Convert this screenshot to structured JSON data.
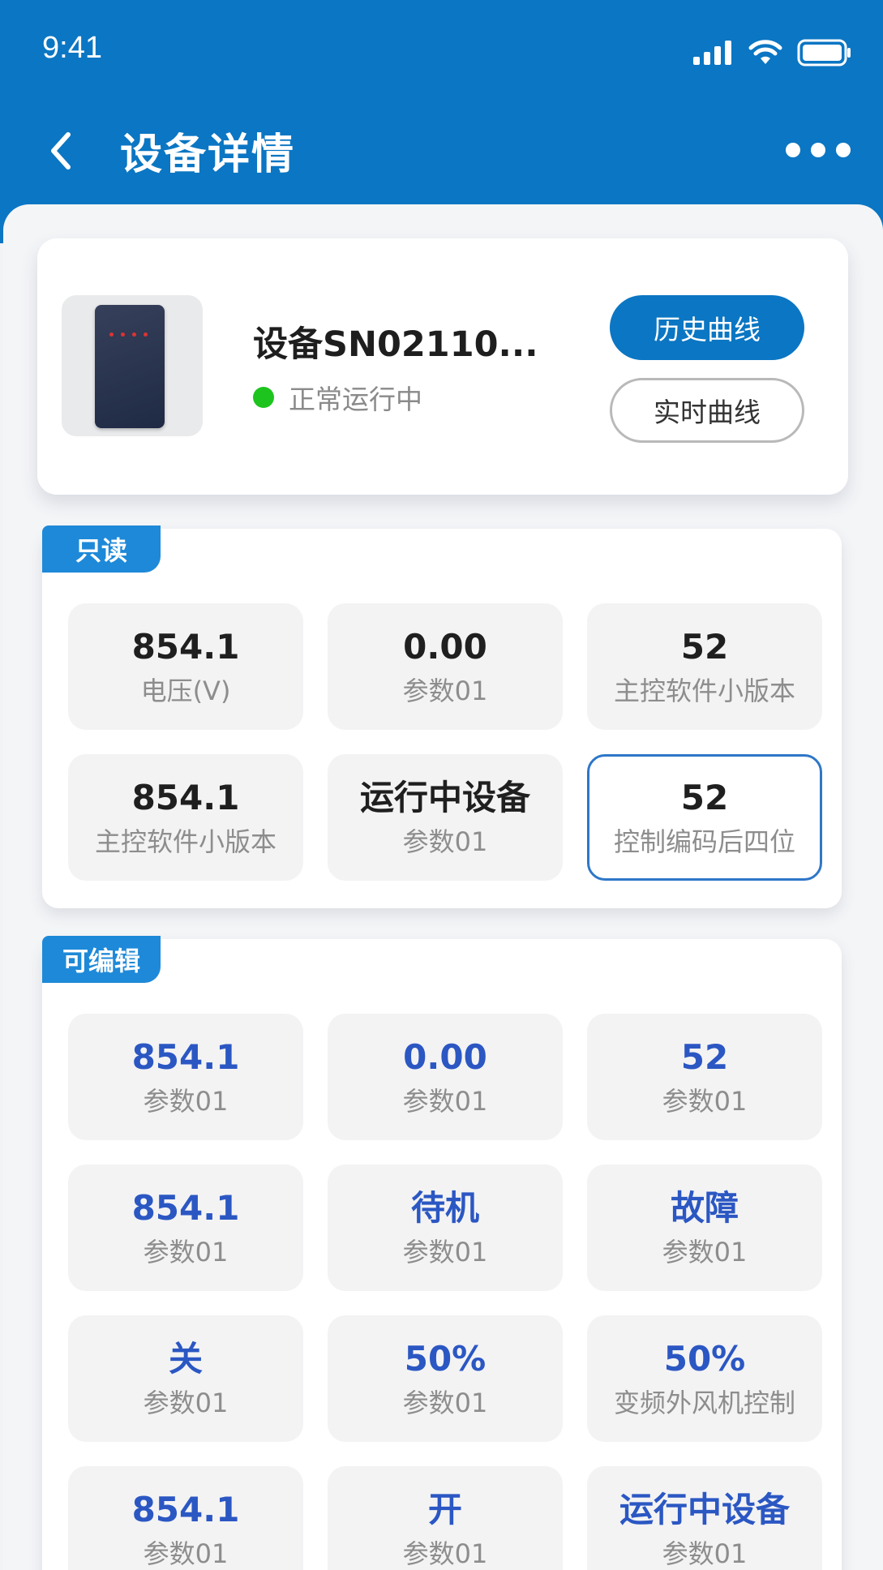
{
  "status_bar": {
    "time": "9:41"
  },
  "nav": {
    "title": "设备详情"
  },
  "device": {
    "name": "设备SN02110...",
    "status": "正常运行中",
    "status_color": "#1ec41e",
    "history_button": "历史曲线",
    "realtime_button": "实时曲线"
  },
  "readonly": {
    "tag": "只读",
    "items": [
      {
        "value": "854.1",
        "label": "电压(V)"
      },
      {
        "value": "0.00",
        "label": "参数01"
      },
      {
        "value": "52",
        "label": "主控软件小版本"
      },
      {
        "value": "854.1",
        "label": "主控软件小版本"
      },
      {
        "value": "运行中设备",
        "label": "参数01"
      },
      {
        "value": "52",
        "label": "控制编码后四位"
      }
    ]
  },
  "editable": {
    "tag": "可编辑",
    "items": [
      {
        "value": "854.1",
        "label": "参数01"
      },
      {
        "value": "0.00",
        "label": "参数01"
      },
      {
        "value": "52",
        "label": "参数01"
      },
      {
        "value": "854.1",
        "label": "参数01"
      },
      {
        "value": "待机",
        "label": "参数01"
      },
      {
        "value": "故障",
        "label": "参数01"
      },
      {
        "value": "关",
        "label": "参数01"
      },
      {
        "value": "50%",
        "label": "参数01"
      },
      {
        "value": "50%",
        "label": "变频外风机控制"
      },
      {
        "value": "854.1",
        "label": "参数01"
      },
      {
        "value": "开",
        "label": "参数01"
      },
      {
        "value": "运行中设备",
        "label": "参数01"
      }
    ]
  },
  "colors": {
    "primary": "#0b76c3",
    "value_blue": "#2b57c3",
    "tag_blue": "#1e89d8"
  },
  "icons": [
    "signal-icon",
    "wifi-icon",
    "battery-icon",
    "back-icon",
    "more-icon"
  ]
}
